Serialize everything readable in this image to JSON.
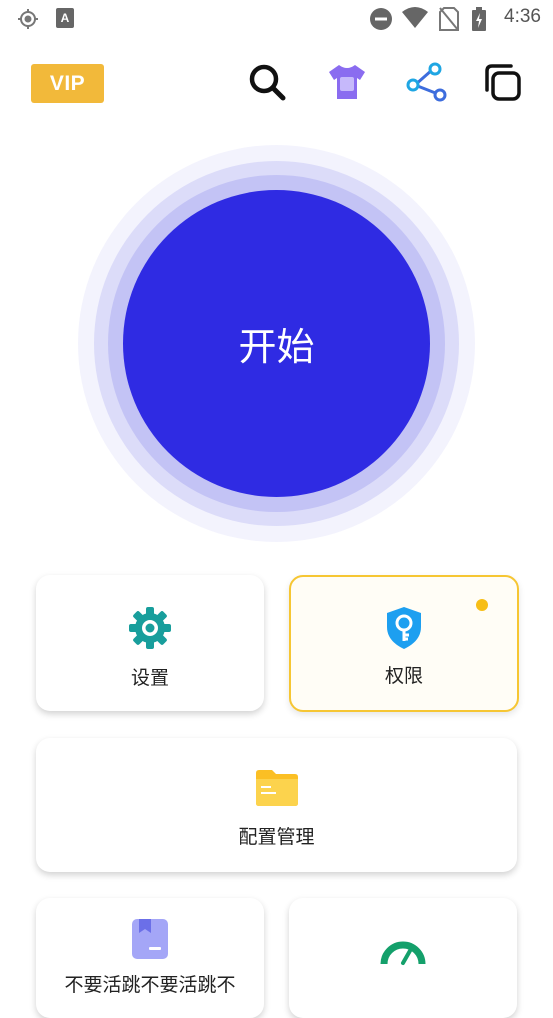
{
  "status_bar": {
    "time": "4:36",
    "icons": [
      "location-icon",
      "keyboard-a-icon",
      "do-not-disturb-icon",
      "wifi-icon",
      "no-sim-icon",
      "battery-charging-icon"
    ]
  },
  "toolbar": {
    "vip_label": "VIP",
    "icons": [
      "search-icon",
      "tshirt-theme-icon",
      "share-icon",
      "copy-icon"
    ]
  },
  "main": {
    "start_label": "开始"
  },
  "cards": {
    "settings": {
      "label": "设置",
      "icon": "gear-icon",
      "color": "#189e9c"
    },
    "permissions": {
      "label": "权限",
      "icon": "shield-key-icon",
      "color": "#1d9ff0",
      "highlight": "#f6c633"
    },
    "config": {
      "label": "配置管理",
      "icon": "folder-icon",
      "color": "#fbbf24"
    },
    "bottom_left": {
      "label": "不要活跳不要活跳不",
      "icon": "bookmark-file-icon",
      "color": "#a4a6f7"
    },
    "bottom_right": {
      "label": "",
      "icon": "speedometer-icon",
      "color": "#14a06b"
    }
  }
}
